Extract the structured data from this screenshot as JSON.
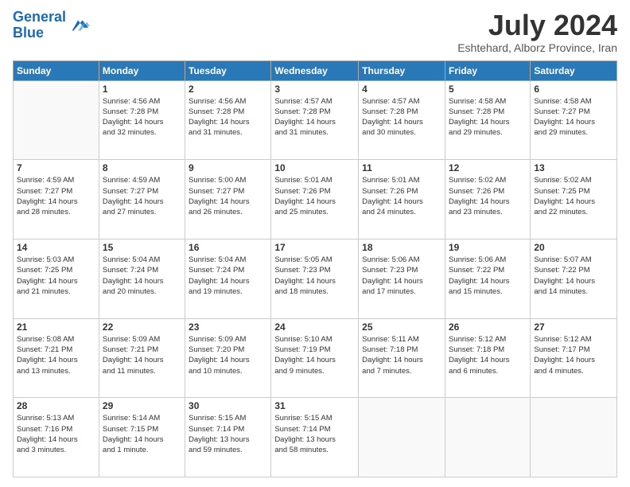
{
  "header": {
    "logo_line1": "General",
    "logo_line2": "Blue",
    "month": "July 2024",
    "location": "Eshtehard, Alborz Province, Iran"
  },
  "days_header": [
    "Sunday",
    "Monday",
    "Tuesday",
    "Wednesday",
    "Thursday",
    "Friday",
    "Saturday"
  ],
  "weeks": [
    [
      {
        "day": "",
        "content": ""
      },
      {
        "day": "1",
        "content": "Sunrise: 4:56 AM\nSunset: 7:28 PM\nDaylight: 14 hours\nand 32 minutes."
      },
      {
        "day": "2",
        "content": "Sunrise: 4:56 AM\nSunset: 7:28 PM\nDaylight: 14 hours\nand 31 minutes."
      },
      {
        "day": "3",
        "content": "Sunrise: 4:57 AM\nSunset: 7:28 PM\nDaylight: 14 hours\nand 31 minutes."
      },
      {
        "day": "4",
        "content": "Sunrise: 4:57 AM\nSunset: 7:28 PM\nDaylight: 14 hours\nand 30 minutes."
      },
      {
        "day": "5",
        "content": "Sunrise: 4:58 AM\nSunset: 7:28 PM\nDaylight: 14 hours\nand 29 minutes."
      },
      {
        "day": "6",
        "content": "Sunrise: 4:58 AM\nSunset: 7:27 PM\nDaylight: 14 hours\nand 29 minutes."
      }
    ],
    [
      {
        "day": "7",
        "content": "Sunrise: 4:59 AM\nSunset: 7:27 PM\nDaylight: 14 hours\nand 28 minutes."
      },
      {
        "day": "8",
        "content": "Sunrise: 4:59 AM\nSunset: 7:27 PM\nDaylight: 14 hours\nand 27 minutes."
      },
      {
        "day": "9",
        "content": "Sunrise: 5:00 AM\nSunset: 7:27 PM\nDaylight: 14 hours\nand 26 minutes."
      },
      {
        "day": "10",
        "content": "Sunrise: 5:01 AM\nSunset: 7:26 PM\nDaylight: 14 hours\nand 25 minutes."
      },
      {
        "day": "11",
        "content": "Sunrise: 5:01 AM\nSunset: 7:26 PM\nDaylight: 14 hours\nand 24 minutes."
      },
      {
        "day": "12",
        "content": "Sunrise: 5:02 AM\nSunset: 7:26 PM\nDaylight: 14 hours\nand 23 minutes."
      },
      {
        "day": "13",
        "content": "Sunrise: 5:02 AM\nSunset: 7:25 PM\nDaylight: 14 hours\nand 22 minutes."
      }
    ],
    [
      {
        "day": "14",
        "content": "Sunrise: 5:03 AM\nSunset: 7:25 PM\nDaylight: 14 hours\nand 21 minutes."
      },
      {
        "day": "15",
        "content": "Sunrise: 5:04 AM\nSunset: 7:24 PM\nDaylight: 14 hours\nand 20 minutes."
      },
      {
        "day": "16",
        "content": "Sunrise: 5:04 AM\nSunset: 7:24 PM\nDaylight: 14 hours\nand 19 minutes."
      },
      {
        "day": "17",
        "content": "Sunrise: 5:05 AM\nSunset: 7:23 PM\nDaylight: 14 hours\nand 18 minutes."
      },
      {
        "day": "18",
        "content": "Sunrise: 5:06 AM\nSunset: 7:23 PM\nDaylight: 14 hours\nand 17 minutes."
      },
      {
        "day": "19",
        "content": "Sunrise: 5:06 AM\nSunset: 7:22 PM\nDaylight: 14 hours\nand 15 minutes."
      },
      {
        "day": "20",
        "content": "Sunrise: 5:07 AM\nSunset: 7:22 PM\nDaylight: 14 hours\nand 14 minutes."
      }
    ],
    [
      {
        "day": "21",
        "content": "Sunrise: 5:08 AM\nSunset: 7:21 PM\nDaylight: 14 hours\nand 13 minutes."
      },
      {
        "day": "22",
        "content": "Sunrise: 5:09 AM\nSunset: 7:21 PM\nDaylight: 14 hours\nand 11 minutes."
      },
      {
        "day": "23",
        "content": "Sunrise: 5:09 AM\nSunset: 7:20 PM\nDaylight: 14 hours\nand 10 minutes."
      },
      {
        "day": "24",
        "content": "Sunrise: 5:10 AM\nSunset: 7:19 PM\nDaylight: 14 hours\nand 9 minutes."
      },
      {
        "day": "25",
        "content": "Sunrise: 5:11 AM\nSunset: 7:18 PM\nDaylight: 14 hours\nand 7 minutes."
      },
      {
        "day": "26",
        "content": "Sunrise: 5:12 AM\nSunset: 7:18 PM\nDaylight: 14 hours\nand 6 minutes."
      },
      {
        "day": "27",
        "content": "Sunrise: 5:12 AM\nSunset: 7:17 PM\nDaylight: 14 hours\nand 4 minutes."
      }
    ],
    [
      {
        "day": "28",
        "content": "Sunrise: 5:13 AM\nSunset: 7:16 PM\nDaylight: 14 hours\nand 3 minutes."
      },
      {
        "day": "29",
        "content": "Sunrise: 5:14 AM\nSunset: 7:15 PM\nDaylight: 14 hours\nand 1 minute."
      },
      {
        "day": "30",
        "content": "Sunrise: 5:15 AM\nSunset: 7:14 PM\nDaylight: 13 hours\nand 59 minutes."
      },
      {
        "day": "31",
        "content": "Sunrise: 5:15 AM\nSunset: 7:14 PM\nDaylight: 13 hours\nand 58 minutes."
      },
      {
        "day": "",
        "content": ""
      },
      {
        "day": "",
        "content": ""
      },
      {
        "day": "",
        "content": ""
      }
    ]
  ]
}
